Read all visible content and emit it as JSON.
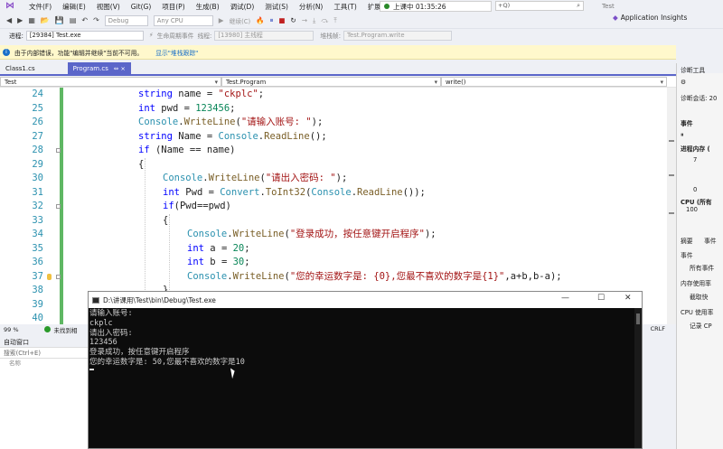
{
  "menu": {
    "items": [
      "文件(F)",
      "编辑(E)",
      "视图(V)",
      "Git(G)",
      "项目(P)",
      "生成(B)",
      "调试(D)",
      "测试(S)",
      "分析(N)",
      "工具(T)",
      "扩展(X)"
    ],
    "recording": "上课中 01:35:26",
    "search_text": "+Q)",
    "solution_title": "Test"
  },
  "toolbar": {
    "config": "Debug",
    "platform": "Any CPU",
    "continue_label": "继续(C)",
    "insights_label": "Application Insights"
  },
  "process_bar": {
    "process_label": "进程:",
    "process_value": "[29384] Test.exe",
    "lifecycle_label": "生命周期事件",
    "thread_label": "线程:",
    "thread_value": "[13980] 主线程",
    "stack_label": "堆栈帧:",
    "stack_value": "Test.Program.write"
  },
  "infobar": {
    "message": "由于内部错误，功能\"编辑并继续\"当前不可用。",
    "link": "显示\"堆栈跟踪\""
  },
  "tabs": [
    {
      "label": "Class1.cs",
      "active": false
    },
    {
      "label": "Program.cs",
      "close": "⇔ ×",
      "active": true
    }
  ],
  "nav": {
    "project": "Test",
    "type": "Test.Program",
    "member": "write()"
  },
  "editor": {
    "lines": [
      {
        "n": "24",
        "indent": 0,
        "tokens": [
          [
            "kw",
            "string"
          ],
          [
            "",
            "name = "
          ],
          [
            "st",
            "\"ckplc\""
          ],
          [
            "",
            ";"
          ]
        ]
      },
      {
        "n": "25",
        "indent": 0,
        "tokens": [
          [
            "kw",
            "int"
          ],
          [
            "",
            "pwd = "
          ],
          [
            "nm",
            "123456"
          ],
          [
            "",
            ";"
          ]
        ]
      },
      {
        "n": "26",
        "indent": 0,
        "tokens": [
          [
            "ty",
            "Console"
          ],
          [
            "",
            "."
          ],
          [
            "mt",
            "WriteLine"
          ],
          [
            "",
            "("
          ],
          [
            "st",
            "\"请输入账号: \""
          ],
          [
            "",
            ");"
          ]
        ]
      },
      {
        "n": "27",
        "indent": 0,
        "tokens": [
          [
            "kw",
            "string"
          ],
          [
            "",
            "Name = "
          ],
          [
            "ty",
            "Console"
          ],
          [
            "",
            "."
          ],
          [
            "mt",
            "ReadLine"
          ],
          [
            "",
            "();"
          ]
        ]
      },
      {
        "n": "28",
        "indent": 0,
        "tokens": [
          [
            "kw",
            "if"
          ],
          [
            "",
            " (Name == name)"
          ]
        ]
      },
      {
        "n": "29",
        "indent": 0,
        "tokens": [
          [
            "",
            "{"
          ]
        ]
      },
      {
        "n": "30",
        "indent": 1,
        "tokens": [
          [
            "ty",
            "Console"
          ],
          [
            "",
            "."
          ],
          [
            "mt",
            "WriteLine"
          ],
          [
            "",
            "("
          ],
          [
            "st",
            "\"请出入密码: \""
          ],
          [
            "",
            ");"
          ]
        ]
      },
      {
        "n": "31",
        "indent": 1,
        "tokens": [
          [
            "kw",
            "int"
          ],
          [
            "",
            "Pwd = "
          ],
          [
            "ty",
            "Convert"
          ],
          [
            "",
            "."
          ],
          [
            "mt",
            "ToInt32"
          ],
          [
            "",
            "("
          ],
          [
            "ty",
            "Console"
          ],
          [
            "",
            "."
          ],
          [
            "mt",
            "ReadLine"
          ],
          [
            "",
            "());"
          ]
        ]
      },
      {
        "n": "32",
        "indent": 1,
        "tokens": [
          [
            "kw",
            "if"
          ],
          [
            "",
            "(Pwd==pwd)"
          ]
        ]
      },
      {
        "n": "33",
        "indent": 1,
        "tokens": [
          [
            "",
            "{"
          ]
        ]
      },
      {
        "n": "34",
        "indent": 2,
        "tokens": [
          [
            "ty",
            "Console"
          ],
          [
            "",
            "."
          ],
          [
            "mt",
            "WriteLine"
          ],
          [
            "",
            "("
          ],
          [
            "st",
            "\"登录成功，按任意键开启程序\""
          ],
          [
            "",
            ");"
          ]
        ]
      },
      {
        "n": "35",
        "indent": 2,
        "tokens": [
          [
            "kw",
            "int"
          ],
          [
            "",
            "a = "
          ],
          [
            "nm",
            "20"
          ],
          [
            "",
            ";"
          ]
        ]
      },
      {
        "n": "36",
        "indent": 2,
        "tokens": [
          [
            "kw",
            "int"
          ],
          [
            "",
            "b = "
          ],
          [
            "nm",
            "30"
          ],
          [
            "",
            ";"
          ]
        ]
      },
      {
        "n": "37",
        "indent": 2,
        "tokens": [
          [
            "ty",
            "Console"
          ],
          [
            "",
            "."
          ],
          [
            "mt",
            "WriteLine"
          ],
          [
            "",
            "("
          ],
          [
            "st",
            "\"您的幸运数字是: {0},您最不喜欢的数字是{1}\""
          ],
          [
            "",
            ",a+b,b-a);"
          ]
        ]
      },
      {
        "n": "38",
        "indent": 1,
        "tokens": [
          [
            "",
            "}"
          ]
        ]
      },
      {
        "n": "39",
        "indent": 0,
        "tokens": [
          [
            "",
            ""
          ]
        ]
      },
      {
        "n": "40",
        "indent": 0,
        "tokens": [
          [
            "",
            ""
          ]
        ]
      }
    ]
  },
  "status": {
    "zoom": "99 %",
    "issues": "未找到相",
    "eol": "CRLF"
  },
  "autos": {
    "title": "自动窗口",
    "search_placeholder": "搜索(Ctrl+E)",
    "col_name": "名称"
  },
  "console": {
    "title": "D:\\讲课用\\Test\\bin\\Debug\\Test.exe",
    "lines": [
      "请输入账号:",
      "ckplc",
      "请出入密码:",
      "123456",
      "登录成功，按任意键开启程序",
      "您的幸运数字是: 50,您最不喜欢的数字是10"
    ]
  },
  "diagnostics": {
    "title": "诊断工具",
    "session": "诊断会话: 20",
    "events": "事件",
    "memory": "进程内存 (",
    "mem_top": "7",
    "mem_bottom": "0",
    "cpu": "CPU (所有",
    "cpu_val": "100",
    "tab_summary": "摘要",
    "tab_events": "事件",
    "events2": "事件",
    "all_events": "所有事件",
    "mem_usage": "内存使用率",
    "snapshot": "截取快",
    "cpu_usage": "CPU 使用率",
    "record_cpu": "记录 CP"
  }
}
